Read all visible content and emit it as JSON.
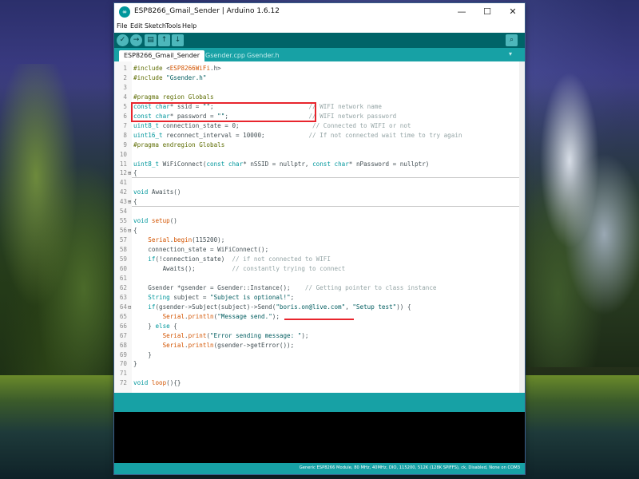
{
  "window": {
    "title": "ESP8266_Gmail_Sender | Arduino 1.6.12",
    "icon_label": "∞",
    "controls": {
      "minimize": "—",
      "maximize": "☐",
      "close": "✕"
    }
  },
  "menu": [
    "File",
    "Edit",
    "Sketch",
    "Tools",
    "Help"
  ],
  "toolbar": {
    "verify": "✓",
    "upload": "→",
    "new": "▤",
    "open": "↑",
    "save": "↓",
    "serial_monitor": "⌕"
  },
  "tabs": [
    "ESP8266_Gmail_Sender",
    "Gsender.cpp",
    "Gsender.h"
  ],
  "tab_menu": "▾",
  "code": [
    {
      "n": "1",
      "t": [
        {
          "c": "pp",
          "v": "#include "
        },
        {
          "c": "",
          "v": "<"
        },
        {
          "c": "lnk",
          "v": "ESP8266WiFi"
        },
        {
          "c": "",
          "v": ".h>"
        }
      ]
    },
    {
      "n": "2",
      "t": [
        {
          "c": "pp",
          "v": "#include "
        },
        {
          "c": "st",
          "v": "\"Gsender.h\""
        }
      ]
    },
    {
      "n": "3",
      "t": []
    },
    {
      "n": "4",
      "t": [
        {
          "c": "pp",
          "v": "#pragma region Globals"
        }
      ]
    },
    {
      "n": "5",
      "t": [
        {
          "c": "kw",
          "v": "const"
        },
        {
          "c": "",
          "v": " "
        },
        {
          "c": "ty",
          "v": "char"
        },
        {
          "c": "",
          "v": "* ssid = "
        },
        {
          "c": "st",
          "v": "\"\""
        },
        {
          "c": "",
          "v": ";                          "
        },
        {
          "c": "cm",
          "v": "// WIFI network name"
        }
      ]
    },
    {
      "n": "6",
      "t": [
        {
          "c": "kw",
          "v": "const"
        },
        {
          "c": "",
          "v": " "
        },
        {
          "c": "ty",
          "v": "char"
        },
        {
          "c": "",
          "v": "* password = "
        },
        {
          "c": "st",
          "v": "\"\""
        },
        {
          "c": "",
          "v": ";                      "
        },
        {
          "c": "cm",
          "v": "// WIFI network password"
        }
      ]
    },
    {
      "n": "7",
      "t": [
        {
          "c": "ty",
          "v": "uint8_t"
        },
        {
          "c": "",
          "v": " connection_state = 0;                    "
        },
        {
          "c": "cm",
          "v": "// Connected to WIFI or not"
        }
      ]
    },
    {
      "n": "8",
      "t": [
        {
          "c": "ty",
          "v": "uint16_t"
        },
        {
          "c": "",
          "v": " reconnect_interval = 10000;            "
        },
        {
          "c": "cm",
          "v": "// If not connected wait time to try again"
        }
      ]
    },
    {
      "n": "9",
      "t": [
        {
          "c": "pp",
          "v": "#pragma endregion Globals"
        }
      ]
    },
    {
      "n": "10",
      "t": []
    },
    {
      "n": "11",
      "t": [
        {
          "c": "ty",
          "v": "uint8_t"
        },
        {
          "c": "",
          "v": " WiFiConnect("
        },
        {
          "c": "kw",
          "v": "const"
        },
        {
          "c": "",
          "v": " "
        },
        {
          "c": "ty",
          "v": "char"
        },
        {
          "c": "",
          "v": "* nSSID = nullptr, "
        },
        {
          "c": "kw",
          "v": "const"
        },
        {
          "c": "",
          "v": " "
        },
        {
          "c": "ty",
          "v": "char"
        },
        {
          "c": "",
          "v": "* nPassword = nullptr)"
        }
      ]
    },
    {
      "n": "12",
      "f": "⊞",
      "t": [
        {
          "c": "",
          "v": "{"
        }
      ],
      "sep": true
    },
    {
      "n": "41",
      "t": []
    },
    {
      "n": "42",
      "t": [
        {
          "c": "kw",
          "v": "void"
        },
        {
          "c": "",
          "v": " Awaits()"
        }
      ]
    },
    {
      "n": "43",
      "f": "⊞",
      "t": [
        {
          "c": "",
          "v": "{"
        }
      ],
      "sep": true
    },
    {
      "n": "54",
      "t": []
    },
    {
      "n": "55",
      "t": [
        {
          "c": "kw",
          "v": "void"
        },
        {
          "c": "",
          "v": " "
        },
        {
          "c": "fn",
          "v": "setup"
        },
        {
          "c": "",
          "v": "()"
        }
      ]
    },
    {
      "n": "56",
      "f": "⊟",
      "t": [
        {
          "c": "",
          "v": "{"
        }
      ]
    },
    {
      "n": "57",
      "t": [
        {
          "c": "",
          "v": "    "
        },
        {
          "c": "fn",
          "v": "Serial"
        },
        {
          "c": "",
          "v": "."
        },
        {
          "c": "fn",
          "v": "begin"
        },
        {
          "c": "",
          "v": "(115200);"
        }
      ]
    },
    {
      "n": "58",
      "t": [
        {
          "c": "",
          "v": "    connection_state = WiFiConnect();"
        }
      ]
    },
    {
      "n": "59",
      "t": [
        {
          "c": "",
          "v": "    "
        },
        {
          "c": "kw",
          "v": "if"
        },
        {
          "c": "",
          "v": "(!connection_state)  "
        },
        {
          "c": "cm",
          "v": "// if not connected to WIFI"
        }
      ]
    },
    {
      "n": "60",
      "t": [
        {
          "c": "",
          "v": "        Awaits();          "
        },
        {
          "c": "cm",
          "v": "// constantly trying to connect"
        }
      ]
    },
    {
      "n": "61",
      "t": []
    },
    {
      "n": "62",
      "t": [
        {
          "c": "",
          "v": "    Gsender *gsender = Gsender::Instance();    "
        },
        {
          "c": "cm",
          "v": "// Getting pointer to class instance"
        }
      ]
    },
    {
      "n": "63",
      "t": [
        {
          "c": "",
          "v": "    "
        },
        {
          "c": "ty",
          "v": "String"
        },
        {
          "c": "",
          "v": " subject = "
        },
        {
          "c": "st",
          "v": "\"Subject is optional!\""
        },
        {
          "c": "",
          "v": ";"
        }
      ]
    },
    {
      "n": "64",
      "f": "⊟",
      "t": [
        {
          "c": "",
          "v": "    "
        },
        {
          "c": "kw",
          "v": "if"
        },
        {
          "c": "",
          "v": "(gsender->Subject(subject)->Send("
        },
        {
          "c": "st",
          "v": "\"boris.on@live.com\""
        },
        {
          "c": "",
          "v": ", "
        },
        {
          "c": "st",
          "v": "\"Setup test\""
        },
        {
          "c": "",
          "v": ")) {"
        }
      ]
    },
    {
      "n": "65",
      "t": [
        {
          "c": "",
          "v": "        "
        },
        {
          "c": "fn",
          "v": "Serial"
        },
        {
          "c": "",
          "v": "."
        },
        {
          "c": "fn",
          "v": "println"
        },
        {
          "c": "",
          "v": "("
        },
        {
          "c": "st",
          "v": "\"Message send.\""
        },
        {
          "c": "",
          "v": ");"
        }
      ]
    },
    {
      "n": "66",
      "t": [
        {
          "c": "",
          "v": "    } "
        },
        {
          "c": "kw",
          "v": "else"
        },
        {
          "c": "",
          "v": " {"
        }
      ]
    },
    {
      "n": "67",
      "t": [
        {
          "c": "",
          "v": "        "
        },
        {
          "c": "fn",
          "v": "Serial"
        },
        {
          "c": "",
          "v": "."
        },
        {
          "c": "fn",
          "v": "print"
        },
        {
          "c": "",
          "v": "("
        },
        {
          "c": "st",
          "v": "\"Error sending message: \""
        },
        {
          "c": "",
          "v": ");"
        }
      ]
    },
    {
      "n": "68",
      "t": [
        {
          "c": "",
          "v": "        "
        },
        {
          "c": "fn",
          "v": "Serial"
        },
        {
          "c": "",
          "v": "."
        },
        {
          "c": "fn",
          "v": "println"
        },
        {
          "c": "",
          "v": "(gsender->getError());"
        }
      ]
    },
    {
      "n": "69",
      "t": [
        {
          "c": "",
          "v": "    }"
        }
      ]
    },
    {
      "n": "70",
      "t": [
        {
          "c": "",
          "v": "}"
        }
      ]
    },
    {
      "n": "71",
      "t": []
    },
    {
      "n": "72",
      "t": [
        {
          "c": "kw",
          "v": "void"
        },
        {
          "c": "",
          "v": " "
        },
        {
          "c": "fn",
          "v": "loop"
        },
        {
          "c": "",
          "v": "(){}"
        }
      ]
    }
  ],
  "status_bar": {
    "board": "Generic ESP8266 Module, 80 MHz, 40MHz, DIO, 115200, 512K (128K SPIFFS), ck, Disabled, None on COM3"
  },
  "colors": {
    "toolbar": "#006468",
    "tabbar": "#17a1a5",
    "keyword": "#00979c",
    "function": "#d35400",
    "highlight": "#e8252d"
  }
}
